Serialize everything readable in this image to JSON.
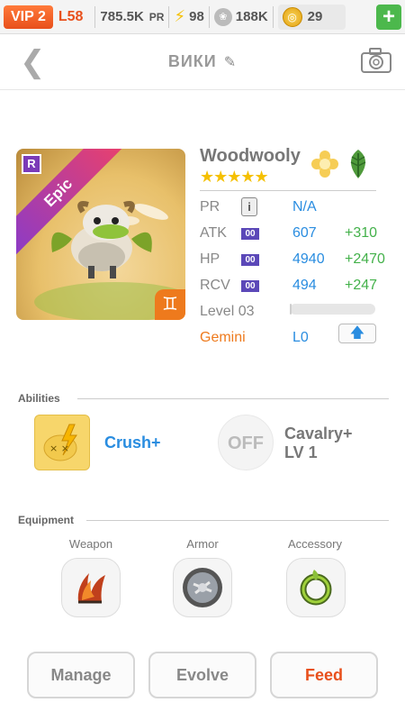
{
  "topbar": {
    "vip_label": "VIP 2",
    "level": "L58",
    "power": "785.5K",
    "power_unit": "PR",
    "energy": "98",
    "paw_count": "188K",
    "coins": "29",
    "add_label": "+"
  },
  "header": {
    "title": "ВИКИ"
  },
  "pet": {
    "rarity": "Epic",
    "rank_badge": "R",
    "name": "Woodwooly",
    "star_count": 5,
    "stars": "★★★★★",
    "zodiac_symbol": "♊",
    "elements": [
      "light-icon",
      "wood-icon"
    ],
    "stats": {
      "pr_label": "PR",
      "pr_value": "N/A",
      "atk_label": "ATK",
      "atk_badge": "00",
      "atk_value": "607",
      "atk_bonus": "+310",
      "hp_label": "HP",
      "hp_badge": "00",
      "hp_value": "4940",
      "hp_bonus": "+2470",
      "rcv_label": "RCV",
      "rcv_badge": "00",
      "rcv_value": "494",
      "rcv_bonus": "+247",
      "level_label": "Level 03",
      "level_progress": 0.02,
      "constellation_label": "Gemini",
      "constellation_value": "L0"
    }
  },
  "abilities": {
    "heading": "Abilities",
    "items": [
      {
        "name": "Crush+",
        "icon": "crush-icon"
      },
      {
        "name_line1": "Cavalry+",
        "name_line2": "LV 1",
        "state": "OFF",
        "icon": "cavalry-icon"
      }
    ]
  },
  "equipment": {
    "heading": "Equipment",
    "slots": [
      {
        "label": "Weapon",
        "icon": "weapon-claw-icon"
      },
      {
        "label": "Armor",
        "icon": "armor-shield-icon"
      },
      {
        "label": "Accessory",
        "icon": "accessory-ring-icon"
      }
    ]
  },
  "actions": {
    "manage": "Manage",
    "evolve": "Evolve",
    "feed": "Feed"
  },
  "colors": {
    "accent_orange": "#e8501c",
    "value_blue": "#2a8de0",
    "bonus_green": "#43b14a",
    "epic_purple": "#8a3bc8"
  }
}
